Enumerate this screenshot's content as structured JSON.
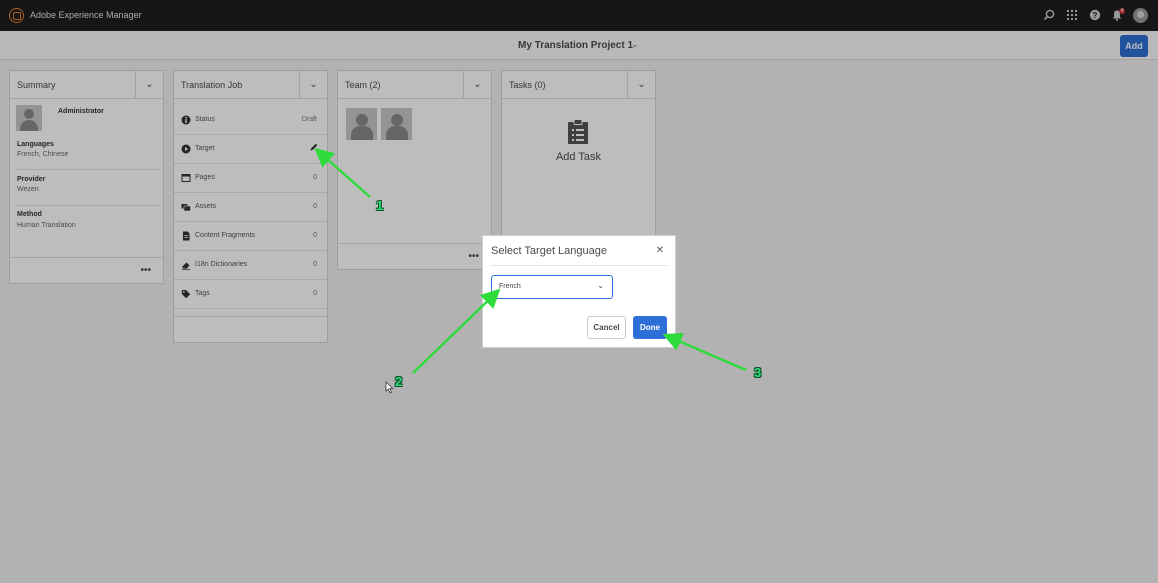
{
  "shell": {
    "app_title": "Adobe Experience Manager",
    "notification_count": "4",
    "icons": [
      "search-icon",
      "apps-grid-icon",
      "help-icon",
      "bell-icon",
      "user-avatar"
    ]
  },
  "actionbar": {
    "project_title": "My Translation Project 1",
    "add_label": "Add"
  },
  "summary_card": {
    "title": "Summary",
    "user_name": "Administrator",
    "fields": [
      {
        "label": "Languages",
        "value": "French, Chinese"
      },
      {
        "label": "Provider",
        "value": "Wezen"
      },
      {
        "label": "Method",
        "value": "Human Translation"
      }
    ]
  },
  "translation_job_card": {
    "title": "Translation Job",
    "rows": [
      {
        "icon": "info-icon",
        "label": "Status",
        "value": "Draft"
      },
      {
        "icon": "play-circle-icon",
        "label": "Target",
        "value": ""
      },
      {
        "icon": "pages-icon",
        "label": "Pages",
        "value": "0"
      },
      {
        "icon": "assets-icon",
        "label": "Assets",
        "value": "0"
      },
      {
        "icon": "document-icon",
        "label": "Content Fragments",
        "value": "0"
      },
      {
        "icon": "eraser-icon",
        "label": "I18n Dictionaries",
        "value": "0"
      },
      {
        "icon": "tag-icon",
        "label": "Tags",
        "value": "0"
      }
    ]
  },
  "team_card": {
    "title": "Team (2)"
  },
  "tasks_card": {
    "title": "Tasks (0)",
    "add_task_label": "Add Task"
  },
  "dialog": {
    "title": "Select Target Language",
    "select_value": "French",
    "cancel_label": "Cancel",
    "done_label": "Done"
  },
  "annotations": {
    "step1": "1",
    "step2": "2",
    "step3": "3",
    "arrow_color": "#2ddc3a"
  },
  "colors": {
    "shell_bg": "#1e1e1e",
    "accent_blue": "#2d6fd6",
    "logo_orange": "#e8822a"
  }
}
